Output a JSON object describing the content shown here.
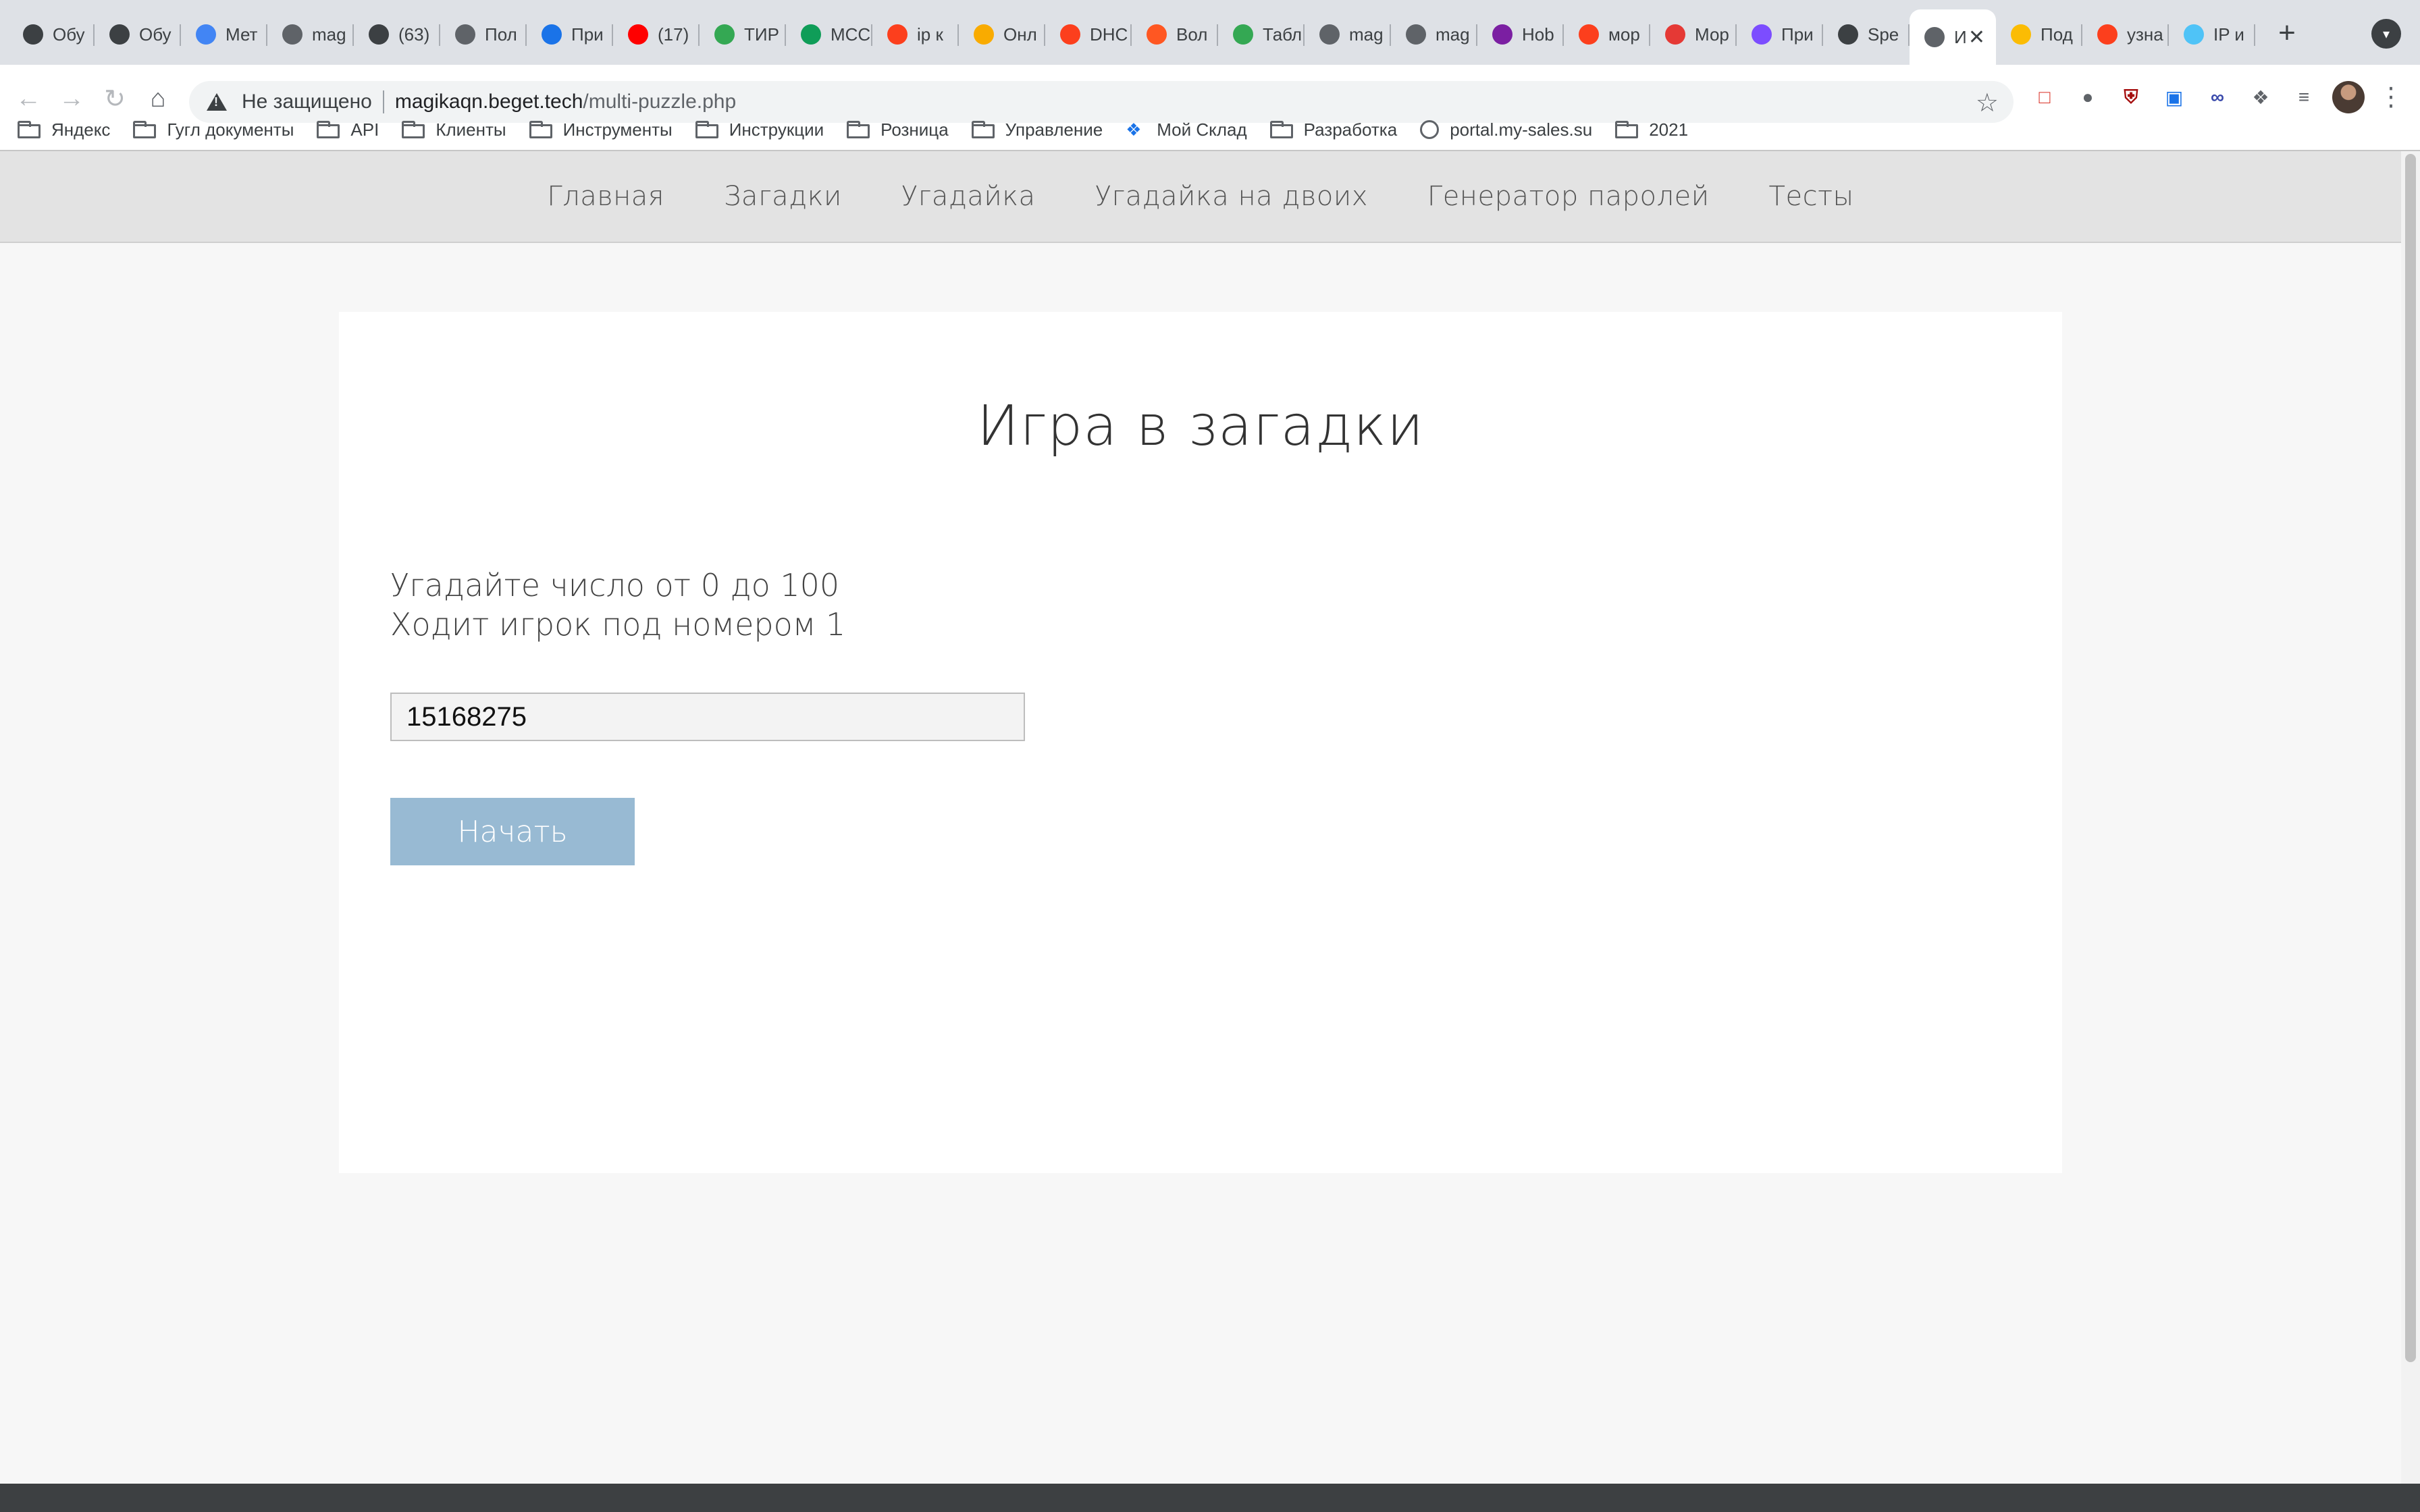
{
  "browser": {
    "tabs": [
      {
        "label": "Обу",
        "icon": "openai-icon"
      },
      {
        "label": "Обу",
        "icon": "openai-icon"
      },
      {
        "label": "Мет",
        "icon": "google-docs-icon"
      },
      {
        "label": "mag",
        "icon": "github-icon"
      },
      {
        "label": "(63)",
        "icon": "arrow-circle-icon"
      },
      {
        "label": "Пол",
        "icon": "globe-icon"
      },
      {
        "label": "При",
        "icon": "drops-icon"
      },
      {
        "label": "(17)",
        "icon": "youtube-icon"
      },
      {
        "label": "ТИР",
        "icon": "google-drive-icon"
      },
      {
        "label": "МСС",
        "icon": "google-sheets-icon"
      },
      {
        "label": "ip к",
        "icon": "yandex-icon"
      },
      {
        "label": "Онл",
        "icon": "calculator-icon"
      },
      {
        "label": "DHC",
        "icon": "yandex-icon"
      },
      {
        "label": "Вол",
        "icon": "blogger-icon"
      },
      {
        "label": "Табл",
        "icon": "code-icon"
      },
      {
        "label": "mag",
        "icon": "github-icon"
      },
      {
        "label": "mag",
        "icon": "github-icon"
      },
      {
        "label": "Hob",
        "icon": "w-icon"
      },
      {
        "label": "мор",
        "icon": "yandex-icon"
      },
      {
        "label": "Мор",
        "icon": "chart-icon"
      },
      {
        "label": "При",
        "icon": "feather-icon"
      },
      {
        "label": "Spe",
        "icon": "speedometer-icon"
      },
      {
        "label": "И",
        "icon": "globe-icon",
        "active": true
      },
      {
        "label": "Под",
        "icon": "play-icon"
      },
      {
        "label": "узна",
        "icon": "yandex-icon"
      },
      {
        "label": "IP и",
        "icon": "ip-icon"
      }
    ],
    "address": {
      "security_label": "Не защищено",
      "host": "magikaqn.beget.tech",
      "path": "/multi-puzzle.php"
    },
    "bookmarks": [
      {
        "label": "Яндекс",
        "icon": "folder-icon"
      },
      {
        "label": "Гугл документы",
        "icon": "folder-icon"
      },
      {
        "label": "API",
        "icon": "folder-icon"
      },
      {
        "label": "Клиенты",
        "icon": "folder-icon"
      },
      {
        "label": "Инструменты",
        "icon": "folder-icon"
      },
      {
        "label": "Инструкции",
        "icon": "folder-icon"
      },
      {
        "label": "Розница",
        "icon": "folder-icon"
      },
      {
        "label": "Управление",
        "icon": "folder-icon"
      },
      {
        "label": "Мой Склад",
        "icon": "drops-icon"
      },
      {
        "label": "Разработка",
        "icon": "folder-icon"
      },
      {
        "label": "portal.my-sales.su",
        "icon": "globe-icon"
      },
      {
        "label": "2021",
        "icon": "folder-icon"
      }
    ]
  },
  "site": {
    "nav": [
      "Главная",
      "Загадки",
      "Угадайка",
      "Угадайка на двоих",
      "Генератор паролей",
      "Тесты"
    ]
  },
  "game": {
    "title": "Игра в загадки",
    "line1": "Угадайте число от 0 до 100",
    "line2": "Ходит игрок под номером 1",
    "input_value": "15168275",
    "start_label": "Начать"
  },
  "colors": {
    "start_button": "#98bad3",
    "nav_background": "#e3e3e3",
    "footer": "#3d4042"
  }
}
